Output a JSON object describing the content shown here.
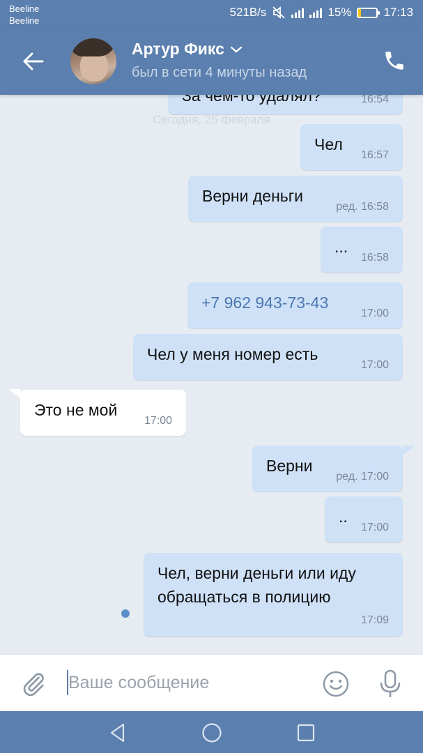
{
  "status_bar": {
    "carrier1": "Beeline",
    "carrier2": "Beeline",
    "speed": "521B/s",
    "battery": "15%",
    "battery_level": 0.15,
    "time": "17:13"
  },
  "header": {
    "name": "Артур Фикс",
    "last_seen": "был в сети 4 минуты назад"
  },
  "chat": {
    "partial_message": "За чем-то удалял?",
    "partial_time": "16:54",
    "date_separator": "Сегодня, 25 февраля",
    "messages": [
      {
        "dir": "out",
        "text": "Чел",
        "time": "16:57"
      },
      {
        "dir": "out",
        "text": "Верни деньги",
        "time": "ред. 16:58"
      },
      {
        "dir": "out",
        "text": "...",
        "time": "16:58"
      },
      {
        "dir": "out",
        "text": "+7 962 943-73-43",
        "time": "17:00"
      },
      {
        "dir": "out",
        "text": "Чел у меня номер есть",
        "time": "17:00"
      },
      {
        "dir": "in",
        "text": "Это не мой",
        "time": "17:00"
      },
      {
        "dir": "out",
        "text": "Верни",
        "time": "ред. 17:00"
      },
      {
        "dir": "out",
        "text": "..",
        "time": "17:00"
      },
      {
        "dir": "out",
        "text_line1": "Чел, верни деньги или иду",
        "text_line2": "обращаться в полицию",
        "time": "17:09"
      }
    ]
  },
  "composer": {
    "placeholder": "Ваше сообщение"
  },
  "icons": {
    "back": "arrow-left-icon",
    "phone": "phone-icon",
    "attach": "paperclip-icon",
    "emoji": "smiley-icon",
    "mic": "microphone-icon",
    "nav_back": "triangle-back-icon",
    "nav_home": "circle-home-icon",
    "nav_recent": "square-recent-icon"
  },
  "colors": {
    "header": "#5b7fae",
    "outgoing_bubble": "#cfe1f7",
    "incoming_bubble": "#ffffff",
    "chat_background": "#e6ecf2",
    "link": "#4a78b0"
  }
}
